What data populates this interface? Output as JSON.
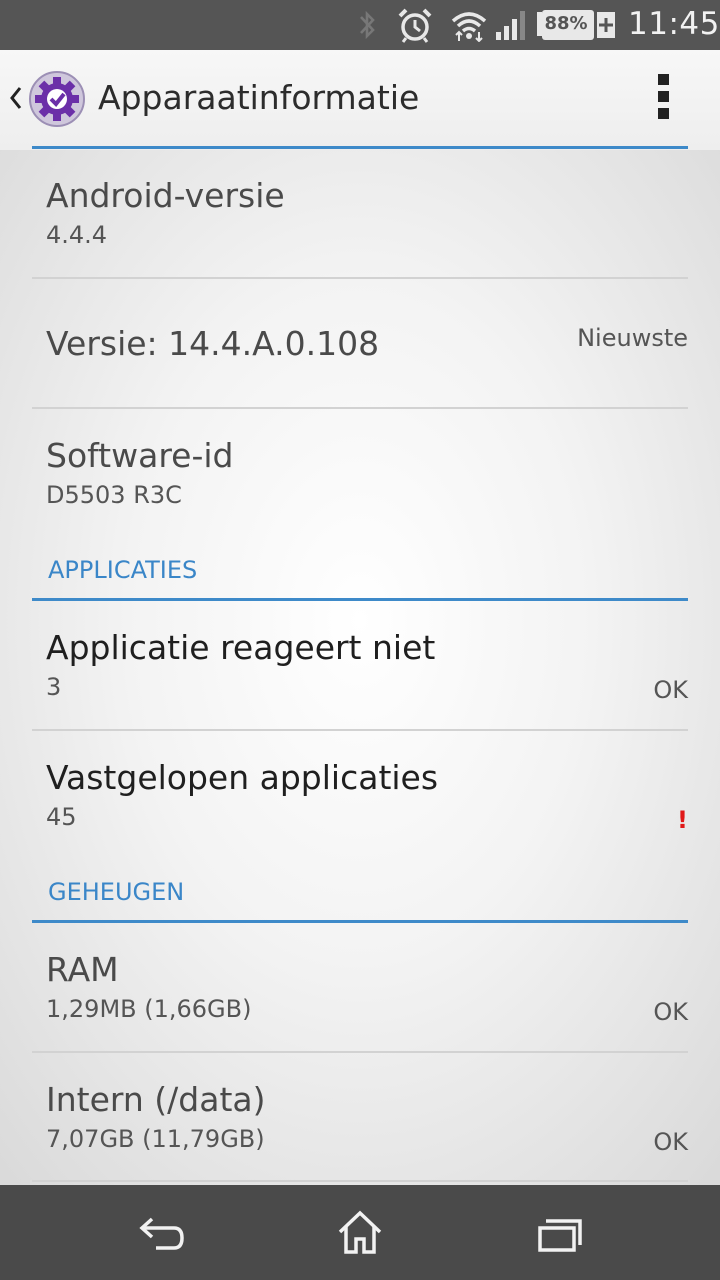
{
  "status_bar": {
    "icons": [
      "bluetooth-icon",
      "alarm-icon",
      "wifi-icon",
      "signal-icon",
      "battery-icon",
      "charging-icon"
    ],
    "battery_percent": "88%",
    "time": "11:45"
  },
  "action_bar": {
    "title": "Apparaatinformatie",
    "app_icon": "settings-check-icon",
    "overflow_icon": "overflow-menu-icon"
  },
  "items": {
    "android_version": {
      "title": "Android-versie",
      "value": "4.4.4"
    },
    "build_version": {
      "title": "Versie: 14.4.A.0.108",
      "status": "Nieuwste"
    },
    "software_id": {
      "title": "Software-id",
      "value": "D5503 R3C"
    }
  },
  "sections": {
    "applications": {
      "header": "APPLICATIES",
      "not_responding": {
        "title": "Applicatie reageert niet",
        "value": "3",
        "status": "OK"
      },
      "crashed": {
        "title": "Vastgelopen applicaties",
        "value": "45",
        "status": "!"
      }
    },
    "memory": {
      "header": "GEHEUGEN",
      "ram": {
        "title": "RAM",
        "value": "1,29MB (1,66GB)",
        "status": "OK"
      },
      "internal": {
        "title": "Intern (/data)",
        "value": "7,07GB (11,79GB)",
        "status": "OK"
      }
    }
  },
  "colors": {
    "accent": "#3e8ac9",
    "alert": "#e01818",
    "status_bar": "#555555",
    "nav_bar": "#4a4a4a"
  },
  "nav_bar": {
    "buttons": [
      "back-icon",
      "home-icon",
      "recents-icon"
    ]
  }
}
